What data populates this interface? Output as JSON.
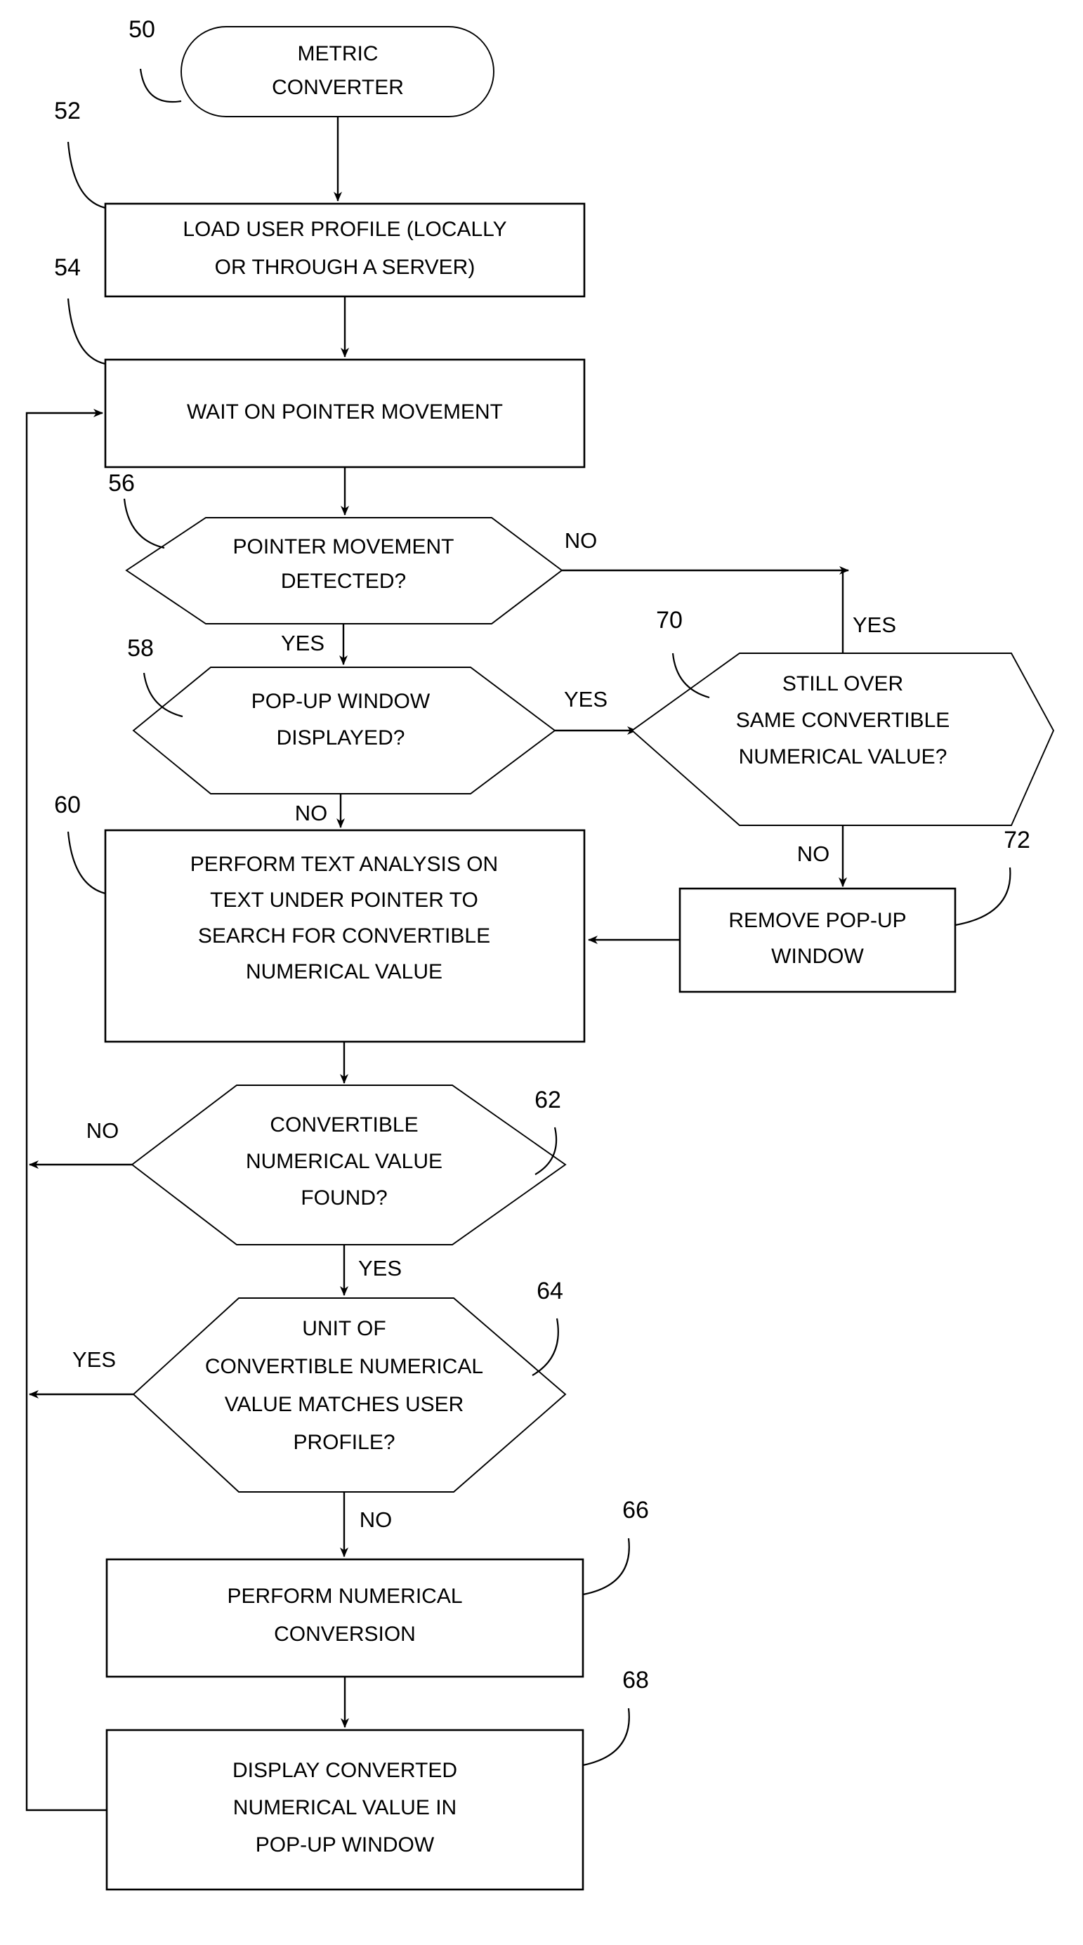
{
  "figure": {
    "type": "flowchart",
    "title": "METRIC CONVERTER process flowchart",
    "background_color": "#ffffff",
    "line_color": "#000000"
  },
  "nodes": {
    "n50": {
      "ref": "50",
      "shape": "terminator",
      "lines": [
        "METRIC",
        "CONVERTER"
      ]
    },
    "n52": {
      "ref": "52",
      "shape": "process",
      "lines": [
        "LOAD USER PROFILE (LOCALLY",
        "OR THROUGH A SERVER)"
      ]
    },
    "n54": {
      "ref": "54",
      "shape": "process",
      "lines": [
        "WAIT ON POINTER MOVEMENT"
      ]
    },
    "n56": {
      "ref": "56",
      "shape": "decision",
      "lines": [
        "POINTER MOVEMENT",
        "DETECTED?"
      ]
    },
    "n58": {
      "ref": "58",
      "shape": "decision",
      "lines": [
        "POP-UP WINDOW",
        "DISPLAYED?"
      ]
    },
    "n60": {
      "ref": "60",
      "shape": "process",
      "lines": [
        "PERFORM TEXT ANALYSIS  ON",
        "TEXT UNDER POINTER TO",
        "SEARCH FOR CONVERTIBLE",
        "NUMERICAL VALUE"
      ]
    },
    "n62": {
      "ref": "62",
      "shape": "decision",
      "lines": [
        "CONVERTIBLE",
        "NUMERICAL VALUE",
        "FOUND?"
      ]
    },
    "n64": {
      "ref": "64",
      "shape": "decision",
      "lines": [
        "UNIT OF",
        "CONVERTIBLE NUMERICAL",
        "VALUE MATCHES USER",
        "PROFILE?"
      ]
    },
    "n66": {
      "ref": "66",
      "shape": "process",
      "lines": [
        "PERFORM NUMERICAL",
        "CONVERSION"
      ]
    },
    "n68": {
      "ref": "68",
      "shape": "process",
      "lines": [
        "DISPLAY CONVERTED",
        "NUMERICAL VALUE IN",
        "POP-UP WINDOW"
      ]
    },
    "n70": {
      "ref": "70",
      "shape": "decision",
      "lines": [
        "STILL OVER",
        "SAME CONVERTIBLE",
        "NUMERICAL VALUE?"
      ]
    },
    "n72": {
      "ref": "72",
      "shape": "process",
      "lines": [
        "REMOVE POP-UP",
        "WINDOW"
      ]
    }
  },
  "edge_labels": {
    "e56_no": "NO",
    "e56_yes": "YES",
    "e58_yes": "YES",
    "e58_no": "NO",
    "e70_yes": "YES",
    "e70_no": "NO",
    "e62_no": "NO",
    "e62_yes": "YES",
    "e64_yes": "YES",
    "e64_no": "NO"
  }
}
